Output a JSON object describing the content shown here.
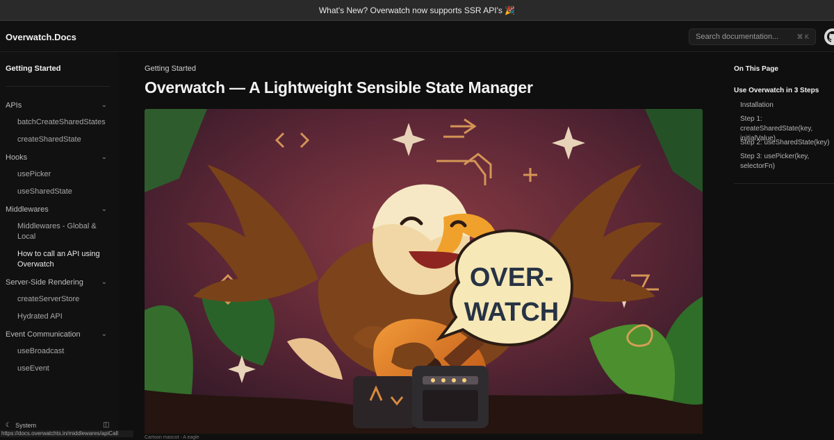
{
  "banner": {
    "text": "What's New? Overwatch now supports SSR API's 🎉"
  },
  "header": {
    "brand": "Overwatch.Docs",
    "search": {
      "placeholder": "Search documentation...",
      "shortcut": "⌘ K"
    }
  },
  "sidebar": {
    "top": "Getting Started",
    "groups": [
      {
        "label": "APIs",
        "items": [
          "batchCreateSharedStates",
          "createSharedState"
        ]
      },
      {
        "label": "Hooks",
        "items": [
          "usePicker",
          "useSharedState"
        ]
      },
      {
        "label": "Middlewares",
        "items": [
          "Middlewares - Global & Local",
          "How to call an API using Overwatch"
        ]
      },
      {
        "label": "Server-Side Rendering",
        "items": [
          "createServerStore",
          "Hydrated API"
        ]
      },
      {
        "label": "Event Communication",
        "items": [
          "useBroadcast",
          "useEvent"
        ]
      }
    ],
    "system": "System",
    "status_url": "https://docs.overwatchts.in/middlewares/apiCall"
  },
  "main": {
    "breadcrumb": "Getting Started",
    "title": "Overwatch — A Lightweight Sensible State Manager",
    "hero_bubble_line1": "OVER-",
    "hero_bubble_line2": "WATCH",
    "caption": "Cartoon mascot - A eagle"
  },
  "toc": {
    "heading": "On This Page",
    "section": "Use Overwatch in 3 Steps",
    "links": [
      "Installation",
      "Step 1: createSharedState(key, initialValue)",
      "Step 2: useSharedState(key)",
      "Step 3: usePicker(key, selectorFn)"
    ]
  },
  "colors": {
    "background": "#0f0f0f",
    "banner": "#2a2a2a",
    "hero_bg": "#6b2c3a",
    "eagle_brown": "#7a4219",
    "bubble": "#f7e8b7"
  }
}
